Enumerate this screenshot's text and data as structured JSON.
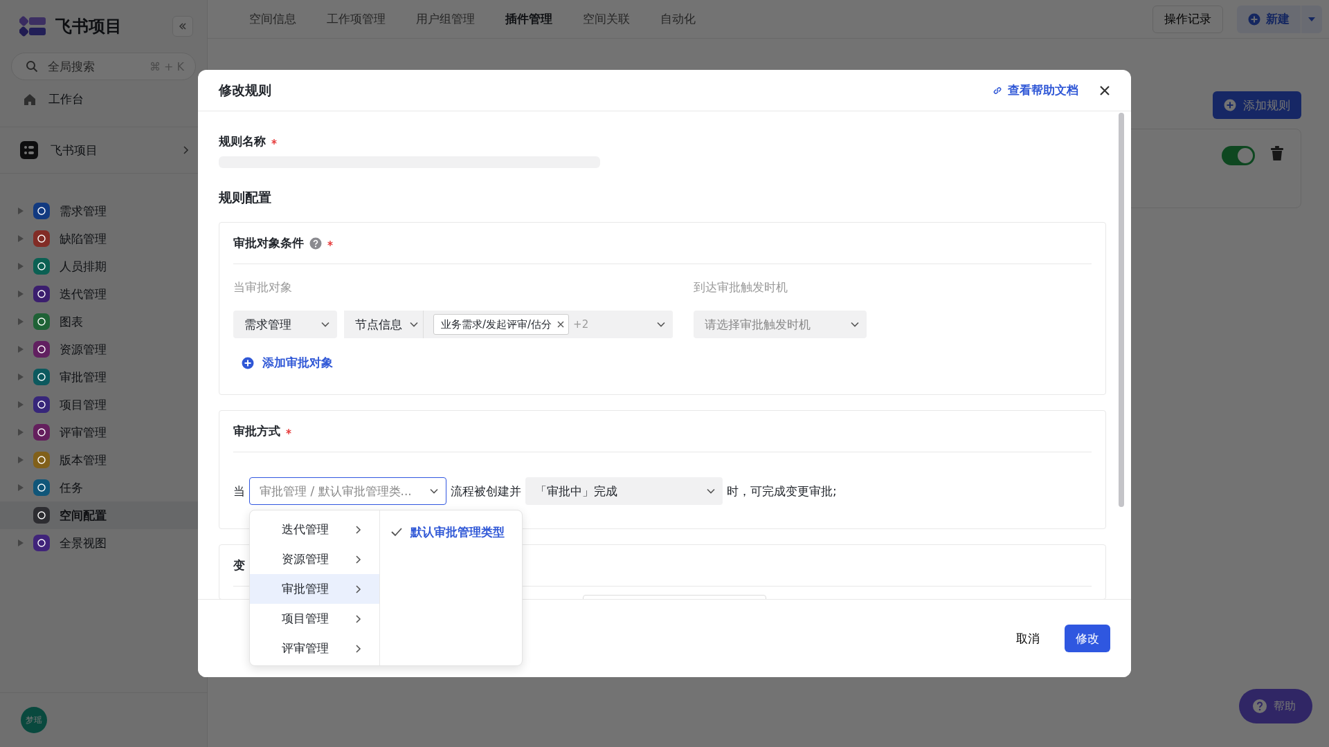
{
  "sidebar": {
    "logo": "飞书项目",
    "search": {
      "placeholder": "全局搜索",
      "shortcut": "⌘ + K"
    },
    "home": "工作台",
    "space": "飞书项目",
    "items": [
      {
        "label": "需求管理",
        "color": "#123a80",
        "selected": false,
        "expandable": true
      },
      {
        "label": "缺陷管理",
        "color": "#822c26",
        "selected": false,
        "expandable": true
      },
      {
        "label": "人员排期",
        "color": "#0b6053",
        "selected": false,
        "expandable": true
      },
      {
        "label": "迭代管理",
        "color": "#3b1e6e",
        "selected": false,
        "expandable": true
      },
      {
        "label": "图表",
        "color": "#1f6236",
        "selected": false,
        "expandable": true
      },
      {
        "label": "资源管理",
        "color": "#612060",
        "selected": false,
        "expandable": true
      },
      {
        "label": "审批管理",
        "color": "#0c595e",
        "selected": false,
        "expandable": true
      },
      {
        "label": "项目管理",
        "color": "#37267a",
        "selected": false,
        "expandable": true
      },
      {
        "label": "评审管理",
        "color": "#641f5d",
        "selected": false,
        "expandable": true
      },
      {
        "label": "版本管理",
        "color": "#81601a",
        "selected": false,
        "expandable": true
      },
      {
        "label": "任务",
        "color": "#105679",
        "selected": false,
        "expandable": true
      },
      {
        "label": "空间配置",
        "color": "#2d2d31",
        "selected": true,
        "expandable": false
      },
      {
        "label": "全景视图",
        "color": "#40247a",
        "selected": false,
        "expandable": true
      }
    ],
    "user": "梦瑶"
  },
  "tabs": [
    {
      "label": "空间信息",
      "selected": false
    },
    {
      "label": "工作项管理",
      "selected": false
    },
    {
      "label": "用户组管理",
      "selected": false
    },
    {
      "label": "插件管理",
      "selected": true
    },
    {
      "label": "空间关联",
      "selected": false
    },
    {
      "label": "自动化",
      "selected": false
    }
  ],
  "top_actions": {
    "history": "操作记录",
    "create": "新建"
  },
  "background": {
    "add_rule": "添加规则",
    "rule_enabled": true
  },
  "help_button": "帮助",
  "dialog": {
    "title": "修改规则",
    "help_link": "查看帮助文档",
    "name_label": "规则名称",
    "config_title": "规则配置",
    "target": {
      "title": "审批对象条件",
      "target_label": "当审批对象",
      "trigger_label": "到达审批触发时机",
      "type_select": "需求管理",
      "field_select": "节点信息",
      "tag": "业务需求/发起评审/估分",
      "more": "+2",
      "trigger_placeholder": "请选择审批触发时机",
      "add": "添加审批对象"
    },
    "method": {
      "title": "审批方式",
      "prefix": "当",
      "flow_select": "审批管理 / 默认审批管理类...",
      "middle": "流程被创建并",
      "state_select": "「审批中」完成",
      "suffix": "时，可完成变更审批;"
    },
    "next_section_title": "变",
    "menu": {
      "items": [
        {
          "label": "迭代管理",
          "selected": false
        },
        {
          "label": "资源管理",
          "selected": false
        },
        {
          "label": "审批管理",
          "selected": true
        },
        {
          "label": "项目管理",
          "selected": false
        },
        {
          "label": "评审管理",
          "selected": false
        }
      ],
      "options": [
        {
          "label": "默认审批管理类型",
          "selected": true
        }
      ]
    },
    "cancel": "取消",
    "submit": "修改"
  }
}
